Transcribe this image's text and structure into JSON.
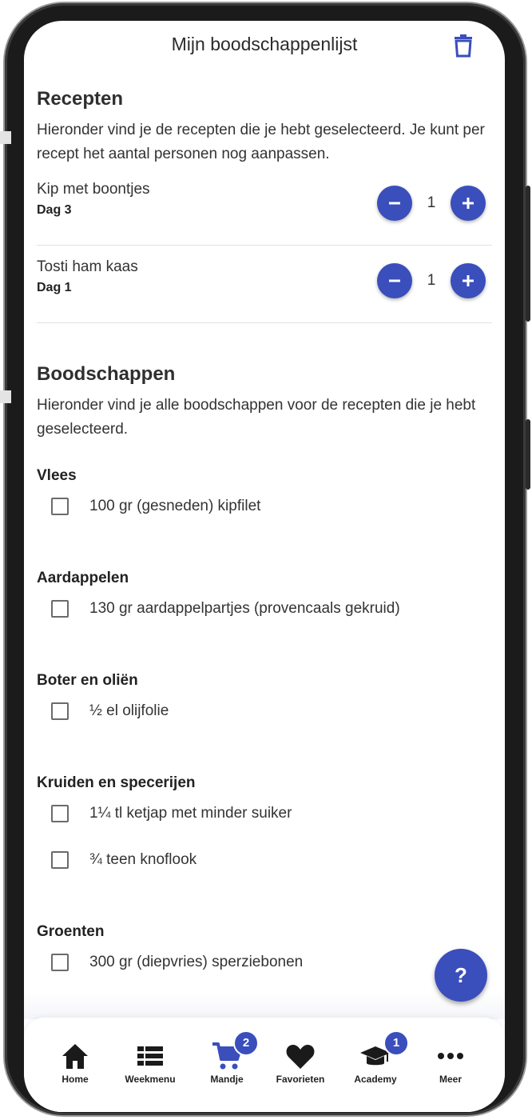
{
  "appbar": {
    "title": "Mijn boodschappenlijst"
  },
  "recipes_section": {
    "title": "Recepten",
    "description": "Hieronder vind je de recepten die je hebt geselecteerd. Je kunt per recept het aantal personen nog aanpassen.",
    "items": [
      {
        "name": "Kip met boontjes",
        "day": "Dag 3",
        "persons": "1"
      },
      {
        "name": "Tosti ham kaas",
        "day": "Dag 1",
        "persons": "1"
      }
    ]
  },
  "groceries_section": {
    "title": "Boodschappen",
    "description": "Hieronder vind je alle boodschappen voor de recepten die je hebt geselecteerd.",
    "categories": [
      {
        "name": "Vlees",
        "items": [
          "100 gr (gesneden) kipfilet"
        ]
      },
      {
        "name": "Aardappelen",
        "items": [
          "130 gr aardappelpartjes (provencaals gekruid)"
        ]
      },
      {
        "name": "Boter en oliën",
        "items": [
          "½ el olijfolie"
        ]
      },
      {
        "name": "Kruiden en specerijen",
        "items": [
          "1¼ tl ketjap met minder suiker",
          "¾ teen knoflook"
        ]
      },
      {
        "name": "Groenten",
        "items": [
          "300 gr (diepvries) sperziebonen"
        ]
      }
    ]
  },
  "fab": {
    "label": "?"
  },
  "bottom_nav": {
    "items": [
      {
        "label": "Home",
        "icon": "home-icon"
      },
      {
        "label": "Weekmenu",
        "icon": "list-icon"
      },
      {
        "label": "Mandje",
        "icon": "cart-icon",
        "badge": "2"
      },
      {
        "label": "Favorieten",
        "icon": "heart-icon"
      },
      {
        "label": "Academy",
        "icon": "graduation-cap-icon",
        "badge": "1"
      },
      {
        "label": "Meer",
        "icon": "more-icon"
      }
    ]
  },
  "colors": {
    "accent": "#3a4ebc",
    "text": "#2b2b2b",
    "divider": "#e2e2e2"
  }
}
